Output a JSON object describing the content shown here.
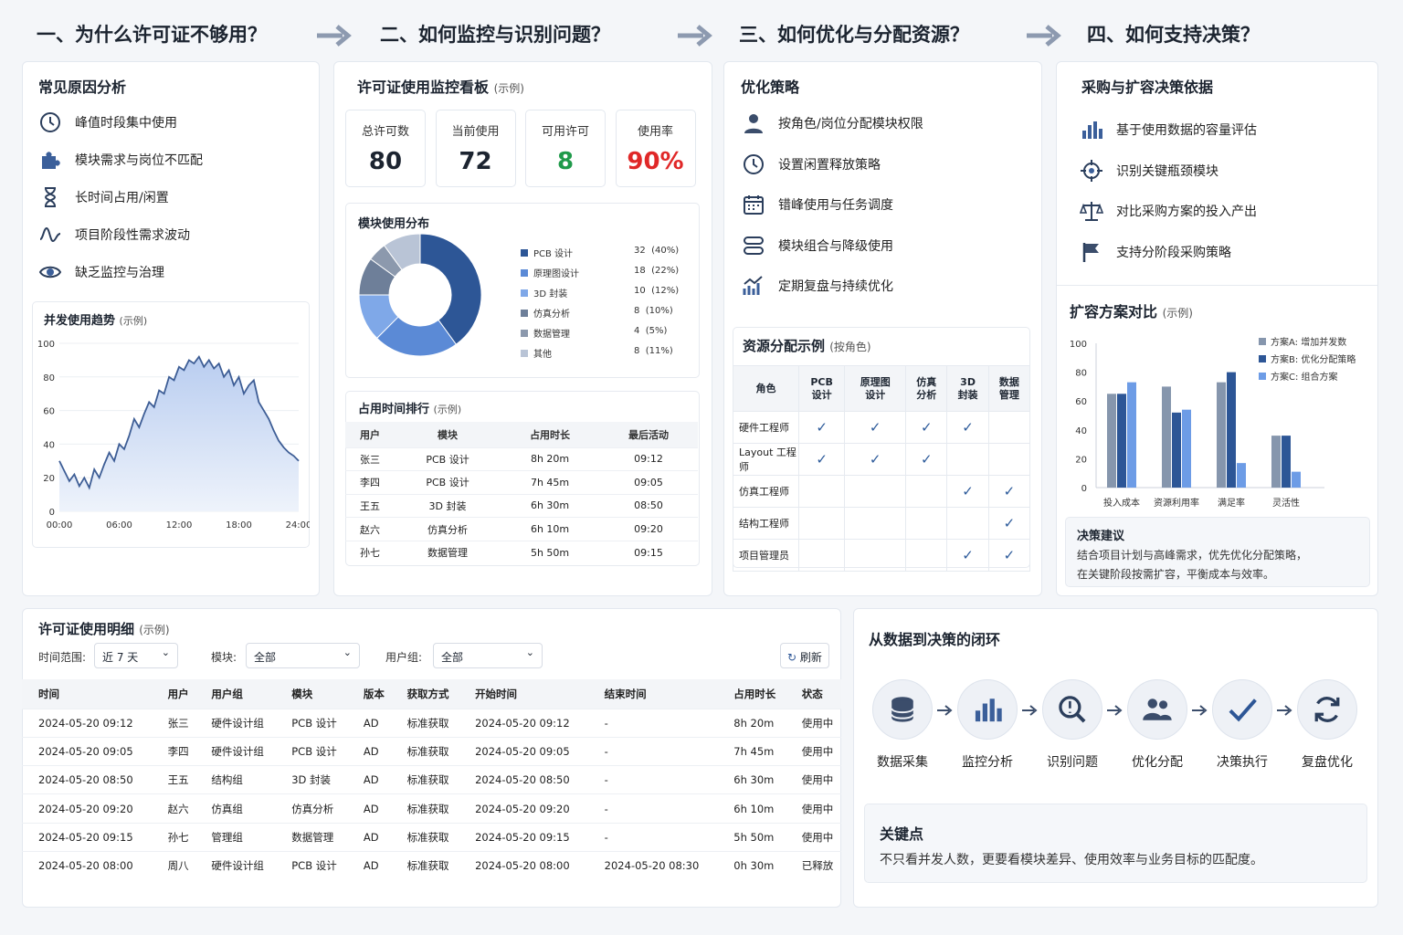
{
  "steps": [
    "一、为什么许可证不够用？",
    "二、如何监控与识别问题？",
    "三、如何优化与分配资源？",
    "四、如何支持决策？"
  ],
  "causes": {
    "title": "常见原因分析",
    "items": [
      {
        "icon": "clock-icon",
        "label": "峰值时段集中使用"
      },
      {
        "icon": "puzzle-icon",
        "label": "模块需求与岗位不匹配"
      },
      {
        "icon": "hourglass-icon",
        "label": "长时间占用/闲置"
      },
      {
        "icon": "wave-icon",
        "label": "项目阶段性需求波动"
      },
      {
        "icon": "eye-icon",
        "label": "缺乏监控与治理"
      }
    ]
  },
  "trend": {
    "title": "并发使用趋势",
    "example": "(示例)"
  },
  "monitor": {
    "title": "许可证使用监控看板",
    "example": "(示例)",
    "kpis": [
      {
        "label": "总许可数",
        "value": "80",
        "color": "#1c2430"
      },
      {
        "label": "当前使用",
        "value": "72",
        "color": "#1c2430"
      },
      {
        "label": "可用许可",
        "value": "8",
        "color": "#1f9a4a"
      },
      {
        "label": "使用率",
        "value": "90%",
        "color": "#e02828"
      }
    ]
  },
  "modules": {
    "title": "模块使用分布"
  },
  "ranking": {
    "title": "占用时间排行",
    "example": "(示例)",
    "headers": [
      "用户",
      "模块",
      "占用时长",
      "最后活动"
    ],
    "rows": [
      [
        "张三",
        "PCB 设计",
        "8h 20m",
        "09:12"
      ],
      [
        "李四",
        "PCB 设计",
        "7h 45m",
        "09:05"
      ],
      [
        "王五",
        "3D 封装",
        "6h 30m",
        "08:50"
      ],
      [
        "赵六",
        "仿真分析",
        "6h 10m",
        "09:20"
      ],
      [
        "孙七",
        "数据管理",
        "5h 50m",
        "09:15"
      ]
    ]
  },
  "strategy": {
    "title": "优化策略",
    "items": [
      {
        "icon": "user-icon",
        "label": "按角色/岗位分配模块权限"
      },
      {
        "icon": "clock-icon",
        "label": "设置闲置释放策略"
      },
      {
        "icon": "calendar-icon",
        "label": "错峰使用与任务调度"
      },
      {
        "icon": "toggle-icon",
        "label": "模块组合与降级使用"
      },
      {
        "icon": "trend-icon",
        "label": "定期复盘与持续优化"
      }
    ]
  },
  "alloc": {
    "title": "资源分配示例",
    "example": "(按角色)",
    "headers": [
      "角色",
      "PCB\n设计",
      "原理图\n设计",
      "仿真\n分析",
      "3D\n封装",
      "数据\n管理"
    ],
    "rows": [
      {
        "role": "硬件工程师",
        "marks": [
          "✓",
          "✓",
          "✓",
          "✓",
          ""
        ]
      },
      {
        "role": "Layout 工程师",
        "marks": [
          "✓",
          "✓",
          "✓",
          "",
          ""
        ]
      },
      {
        "role": "仿真工程师",
        "marks": [
          "",
          "",
          "",
          "✓",
          "✓"
        ]
      },
      {
        "role": "结构工程师",
        "marks": [
          "",
          "",
          "",
          "",
          "✓"
        ]
      },
      {
        "role": "项目管理员",
        "marks": [
          "",
          "",
          "",
          "✓",
          "✓"
        ]
      }
    ]
  },
  "decision": {
    "title": "采购与扩容决策依据",
    "items": [
      {
        "icon": "bar-chart-icon",
        "label": "基于使用数据的容量评估"
      },
      {
        "icon": "target-icon",
        "label": "识别关键瓶颈模块"
      },
      {
        "icon": "balance-icon",
        "label": "对比采购方案的投入产出"
      },
      {
        "icon": "flag-icon",
        "label": "支持分阶段采购策略"
      }
    ]
  },
  "compare": {
    "title": "扩容方案对比",
    "example": "(示例)"
  },
  "advice": {
    "title": "决策建议",
    "lines": [
      "结合项目计划与高峰需求，优先优化分配策略，",
      "在关键阶段按需扩容，平衡成本与效率。"
    ]
  },
  "detail": {
    "title": "许可证使用明细",
    "example": "(示例)",
    "filters": [
      {
        "label": "时间范围:",
        "value": "近 7 天"
      },
      {
        "label": "模块:",
        "value": "全部"
      },
      {
        "label": "用户组:",
        "value": "全部"
      }
    ],
    "refresh": "刷新",
    "headers": [
      "时间",
      "用户",
      "用户组",
      "模块",
      "版本",
      "获取方式",
      "开始时间",
      "结束时间",
      "占用时长",
      "状态"
    ],
    "rows": [
      [
        "2024-05-20 09:12",
        "张三",
        "硬件设计组",
        "PCB 设计",
        "AD",
        "标准获取",
        "2024-05-20 09:12",
        "-",
        "8h 20m",
        "使用中"
      ],
      [
        "2024-05-20 09:05",
        "李四",
        "硬件设计组",
        "PCB 设计",
        "AD",
        "标准获取",
        "2024-05-20 09:05",
        "-",
        "7h 45m",
        "使用中"
      ],
      [
        "2024-05-20 08:50",
        "王五",
        "结构组",
        "3D 封装",
        "AD",
        "标准获取",
        "2024-05-20 08:50",
        "-",
        "6h 30m",
        "使用中"
      ],
      [
        "2024-05-20 09:20",
        "赵六",
        "仿真组",
        "仿真分析",
        "AD",
        "标准获取",
        "2024-05-20 09:20",
        "-",
        "6h 10m",
        "使用中"
      ],
      [
        "2024-05-20 09:15",
        "孙七",
        "管理组",
        "数据管理",
        "AD",
        "标准获取",
        "2024-05-20 09:15",
        "-",
        "5h 50m",
        "使用中"
      ],
      [
        "2024-05-20 08:00",
        "周八",
        "硬件设计组",
        "PCB 设计",
        "AD",
        "标准获取",
        "2024-05-20 08:00",
        "2024-05-20 08:30",
        "0h 30m",
        "已释放"
      ]
    ]
  },
  "loop": {
    "title": "从数据到决策的闭环",
    "nodes": [
      {
        "icon": "database-icon",
        "label": "数据采集"
      },
      {
        "icon": "bar-chart-icon",
        "label": "监控分析"
      },
      {
        "icon": "search-icon",
        "label": "识别问题"
      },
      {
        "icon": "users-icon",
        "label": "优化分配"
      },
      {
        "icon": "check-icon",
        "label": "决策执行"
      },
      {
        "icon": "refresh-icon",
        "label": "复盘优化"
      }
    ]
  },
  "key": {
    "title": "关键点",
    "text": "不只看并发人数，更要看模块差异、使用效率与业务目标的匹配度。"
  },
  "chart_data": [
    {
      "type": "area",
      "title": "并发使用趋势",
      "x_ticks": [
        "00:00",
        "06:00",
        "12:00",
        "18:00",
        "24:00"
      ],
      "ylim": [
        0,
        100
      ],
      "y_ticks": [
        0,
        20,
        40,
        60,
        80,
        100
      ],
      "x": [
        0,
        0.5,
        1,
        1.5,
        2,
        2.5,
        3,
        3.5,
        4,
        4.5,
        5,
        5.5,
        6,
        6.5,
        7,
        7.5,
        8,
        8.5,
        9,
        9.5,
        10,
        10.5,
        11,
        11.5,
        12,
        12.5,
        13,
        13.5,
        14,
        14.5,
        15,
        15.5,
        16,
        16.5,
        17,
        17.5,
        18,
        18.5,
        19,
        19.5,
        20,
        20.5,
        21,
        21.5,
        22,
        22.5,
        23,
        23.5,
        24
      ],
      "y": [
        30,
        24,
        18,
        22,
        15,
        20,
        14,
        25,
        20,
        28,
        35,
        30,
        40,
        37,
        45,
        55,
        50,
        58,
        65,
        62,
        72,
        70,
        80,
        78,
        86,
        84,
        90,
        88,
        92,
        86,
        90,
        85,
        88,
        80,
        84,
        75,
        80,
        70,
        75,
        78,
        65,
        60,
        55,
        48,
        42,
        38,
        35,
        33,
        30
      ]
    },
    {
      "type": "pie",
      "title": "模块使用分布",
      "labels": [
        "PCB 设计",
        "原理图设计",
        "3D 封装",
        "仿真分析",
        "数据管理",
        "其他"
      ],
      "values": [
        32,
        18,
        10,
        8,
        4,
        8
      ],
      "percents": [
        "(40%)",
        "(22%)",
        "(12%)",
        "(10%)",
        "(5%)",
        "(11%)"
      ],
      "colors": [
        "#2d5696",
        "#5b8ad6",
        "#7fa8e8",
        "#6e7f99",
        "#8c99ad",
        "#b9c4d6"
      ]
    },
    {
      "type": "bar",
      "title": "扩容方案对比",
      "categories": [
        "投入成本",
        "资源利用率",
        "满足率",
        "灵活性"
      ],
      "ylim": [
        0,
        100
      ],
      "y_ticks": [
        0,
        20,
        40,
        60,
        80,
        100
      ],
      "series": [
        {
          "name": "方案A: 增加并发数",
          "values": [
            65,
            52,
            80,
            36
          ]
        },
        {
          "name": "方案B: 优化分配策略",
          "values": [
            83,
            39,
            65,
            25
          ]
        },
        {
          "name": "方案C: 组合方案",
          "values": [
            73,
            54,
            17,
            11
          ]
        }
      ],
      "ser_gray": [
        65,
        70,
        73,
        36
      ],
      "colors": [
        "#8696ad",
        "#2d5696",
        "#6d9ce6"
      ]
    }
  ]
}
